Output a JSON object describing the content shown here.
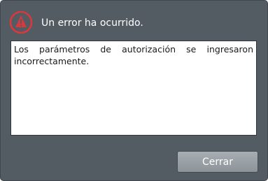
{
  "dialog": {
    "title": "Un error ha ocurrido.",
    "icon": "warning-triangle-icon",
    "message": "Los parámetros de autorización se ingresaron incorrectamente.",
    "close_label": "Cerrar"
  },
  "colors": {
    "background": "#535b63",
    "icon_red": "#d9383c",
    "message_bg": "#ffffff",
    "button": "#9aa1a7"
  }
}
